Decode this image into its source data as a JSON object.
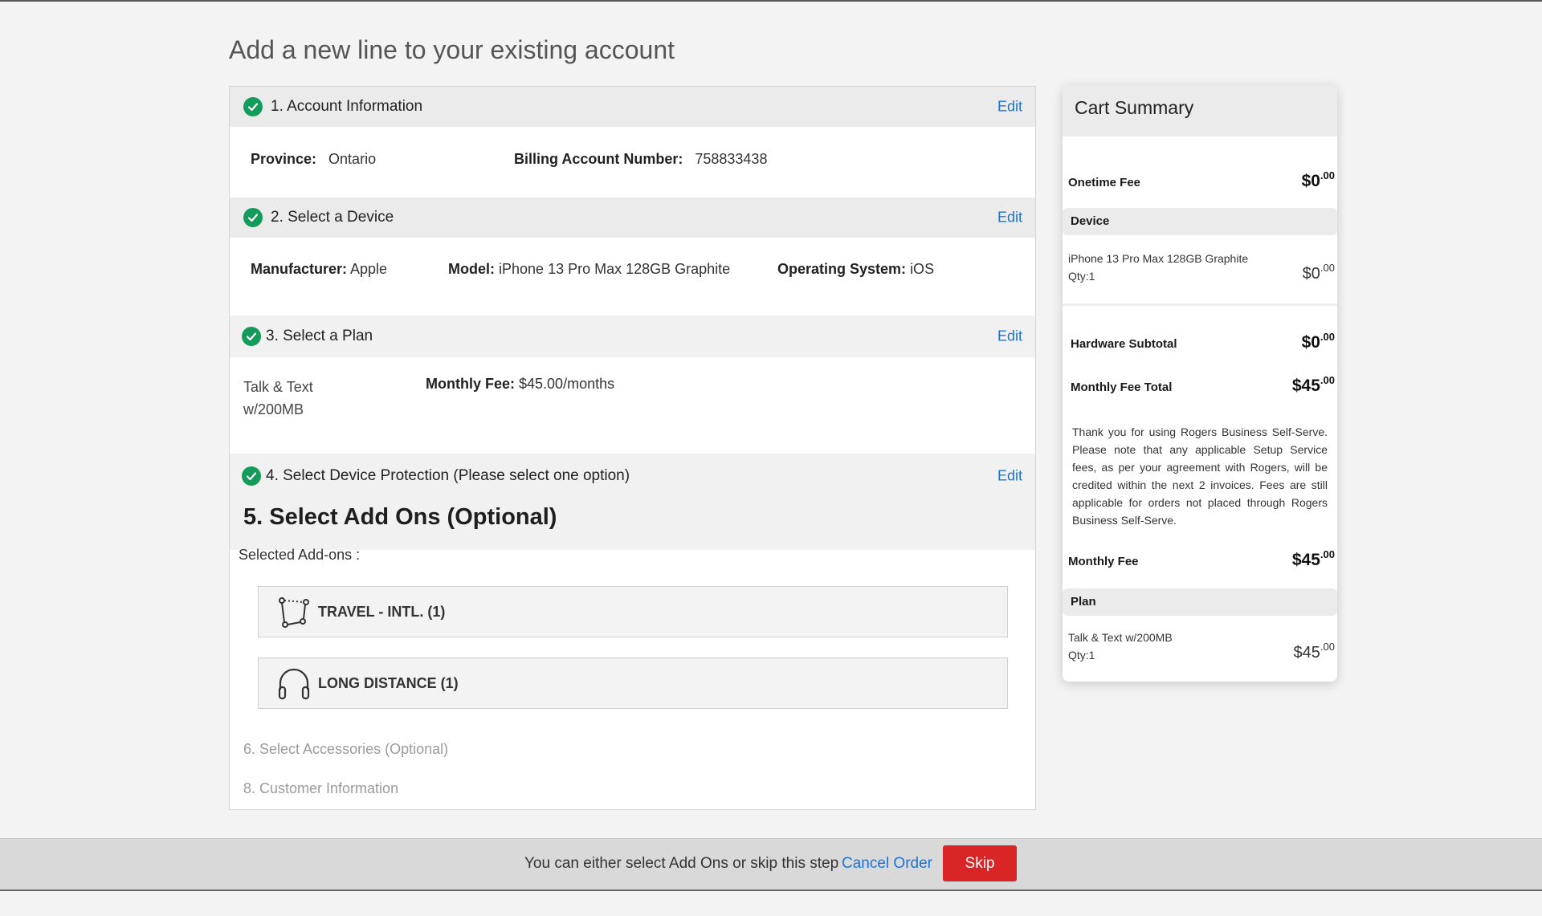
{
  "page": {
    "title": "Add a new line to your existing account"
  },
  "steps": {
    "edit_label": "Edit",
    "account": {
      "title": "1. Account Information",
      "province_label": "Province:",
      "province_value": "Ontario",
      "ban_label": "Billing Account Number:",
      "ban_value": "758833438"
    },
    "device": {
      "title": "2. Select a Device",
      "manufacturer_label": "Manufacturer:",
      "manufacturer_value": "Apple",
      "model_label": "Model:",
      "model_value": "iPhone 13 Pro Max 128GB Graphite",
      "os_label": "Operating System:",
      "os_value": "iOS"
    },
    "plan": {
      "title": "3. Select a Plan",
      "name": "Talk & Text w/200MB",
      "fee_label": "Monthly Fee:",
      "fee_value": "$45.00/months"
    },
    "protection": {
      "title": "4. Select Device Protection (Please select one option)"
    },
    "addons": {
      "title": "5. Select Add Ons (Optional)",
      "selected_label": "Selected Add-ons :",
      "items": [
        {
          "label": "TRAVEL - INTL. (1)",
          "icon": "travel-route-icon"
        },
        {
          "label": "LONG DISTANCE (1)",
          "icon": "headphones-icon"
        }
      ]
    },
    "accessories": {
      "title": "6. Select Accessories (Optional)"
    },
    "customer": {
      "title": "8. Customer Information"
    }
  },
  "cart": {
    "title": "Cart Summary",
    "onetime_fee_label": "Onetime Fee",
    "onetime_fee_dollars": "$0",
    "onetime_fee_cents": ".00",
    "device_band": "Device",
    "device_item": "iPhone 13 Pro Max 128GB Graphite",
    "device_qty": "Qty:1",
    "device_price_dollars": "$0",
    "device_price_cents": ".00",
    "hardware_subtotal_label": "Hardware Subtotal",
    "hardware_subtotal_dollars": "$0",
    "hardware_subtotal_cents": ".00",
    "monthly_total_label": "Monthly Fee Total",
    "monthly_total_dollars": "$45",
    "monthly_total_cents": ".00",
    "note": "Thank you for using Rogers Business Self-Serve. Please note that any applicable Setup Service fees, as per your agreement with Rogers, will be credited within the next 2 invoices. Fees are still applicable for orders not placed through Rogers Business Self-Serve.",
    "monthly_fee_label": "Monthly Fee",
    "monthly_fee_dollars": "$45",
    "monthly_fee_cents": ".00",
    "plan_band": "Plan",
    "plan_item": "Talk & Text w/200MB",
    "plan_qty": "Qty:1",
    "plan_price_dollars": "$45",
    "plan_price_cents": ".00"
  },
  "bottom_bar": {
    "message": "You can either select Add Ons or skip this step",
    "cancel_label": "Cancel Order",
    "skip_label": "Skip"
  },
  "colors": {
    "accent_link": "#1a73d9",
    "check_green": "#149a5a",
    "skip_red": "#d92525"
  }
}
